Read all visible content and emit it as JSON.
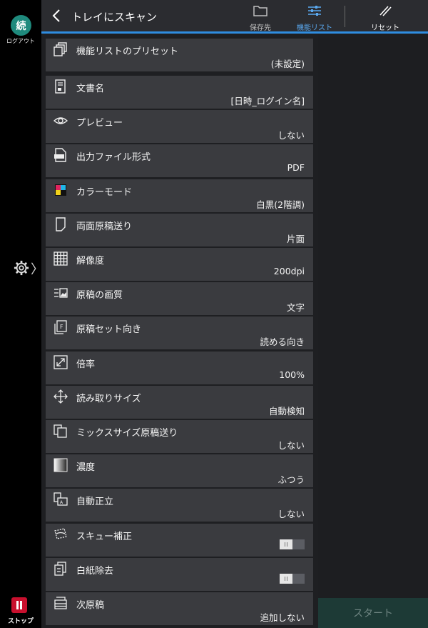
{
  "app": {
    "avatar_text": "続",
    "logout_label": "ログアウト",
    "stop_label": "ストップ",
    "gear_icon": "gear-icon"
  },
  "header": {
    "title": "トレイにスキャン",
    "save_dest_label": "保存先",
    "function_list_label": "機能リスト",
    "reset_label": "リセット",
    "accent_color": "#2f8de0"
  },
  "preset": {
    "name": "機能リストのプリセット",
    "value": "(未設定)"
  },
  "items": [
    {
      "name": "文書名",
      "value": "[日時_ログイン名]",
      "icon": "document-icon"
    },
    {
      "name": "プレビュー",
      "value": "しない",
      "icon": "eye-icon"
    },
    {
      "name": "出力ファイル形式",
      "value": "PDF",
      "icon": "file-format-icon"
    },
    {
      "name": "カラーモード",
      "value": "白黒(2階調)",
      "icon": "color-mode-icon"
    },
    {
      "name": "両面原稿送り",
      "value": "片面",
      "icon": "page-icon"
    },
    {
      "name": "解像度",
      "value": "200dpi",
      "icon": "grid-icon"
    },
    {
      "name": "原稿の画質",
      "value": "文字",
      "icon": "image-quality-icon"
    },
    {
      "name": "原稿セット向き",
      "value": "読める向き",
      "icon": "orientation-icon"
    },
    {
      "name": "倍率",
      "value": "100%",
      "icon": "zoom-icon"
    },
    {
      "name": "読み取りサイズ",
      "value": "自動検知",
      "icon": "move-arrows-icon"
    },
    {
      "name": "ミックスサイズ原稿送り",
      "value": "しない",
      "icon": "mixed-size-icon"
    },
    {
      "name": "濃度",
      "value": "ふつう",
      "icon": "density-icon"
    },
    {
      "name": "自動正立",
      "value": "しない",
      "icon": "auto-rotate-icon"
    },
    {
      "name": "スキュー補正",
      "value": "",
      "icon": "skew-icon",
      "toggle": "off"
    },
    {
      "name": "白紙除去",
      "value": "",
      "icon": "blank-page-icon",
      "toggle": "off"
    },
    {
      "name": "次原稿",
      "value": "追加しない",
      "icon": "next-original-icon"
    }
  ],
  "start_label": "スタート"
}
